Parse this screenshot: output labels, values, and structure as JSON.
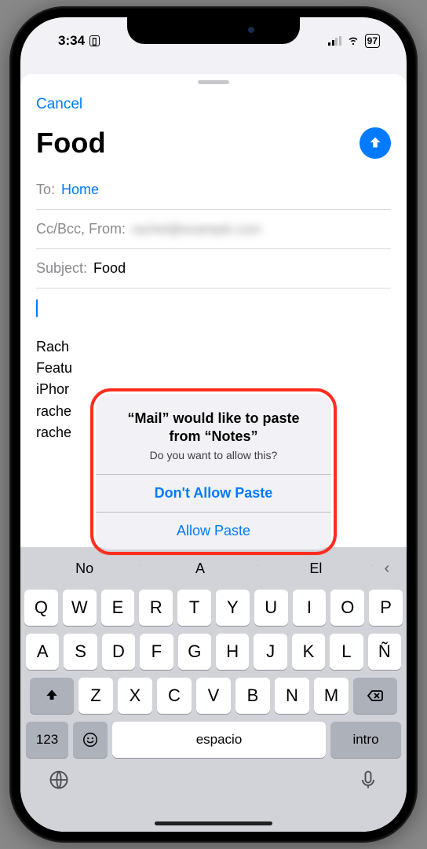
{
  "status": {
    "time": "3:34",
    "battery_pct": "97"
  },
  "nav": {
    "cancel": "Cancel"
  },
  "compose": {
    "title": "Food",
    "to_label": "To:",
    "to_value": "Home",
    "cc_label": "Cc/Bcc, From:",
    "cc_value": "rachel@example.com",
    "subject_label": "Subject:",
    "subject_value": "Food",
    "signature": {
      "l1": "Rach",
      "l2": "Featu",
      "l3": "iPhor",
      "l4": "rache",
      "l5": "rache"
    }
  },
  "alert": {
    "title": "“Mail” would like to paste from “Notes”",
    "message": "Do you want to allow this?",
    "dont_allow": "Don't Allow Paste",
    "allow": "Allow Paste"
  },
  "keyboard": {
    "suggestions": [
      "No",
      "A",
      "El"
    ],
    "row1": [
      "Q",
      "W",
      "E",
      "R",
      "T",
      "Y",
      "U",
      "I",
      "O",
      "P"
    ],
    "row2": [
      "A",
      "S",
      "D",
      "F",
      "G",
      "H",
      "J",
      "K",
      "L",
      "Ñ"
    ],
    "row3": [
      "Z",
      "X",
      "C",
      "V",
      "B",
      "N",
      "M"
    ],
    "numkey": "123",
    "space": "espacio",
    "enter": "intro"
  }
}
